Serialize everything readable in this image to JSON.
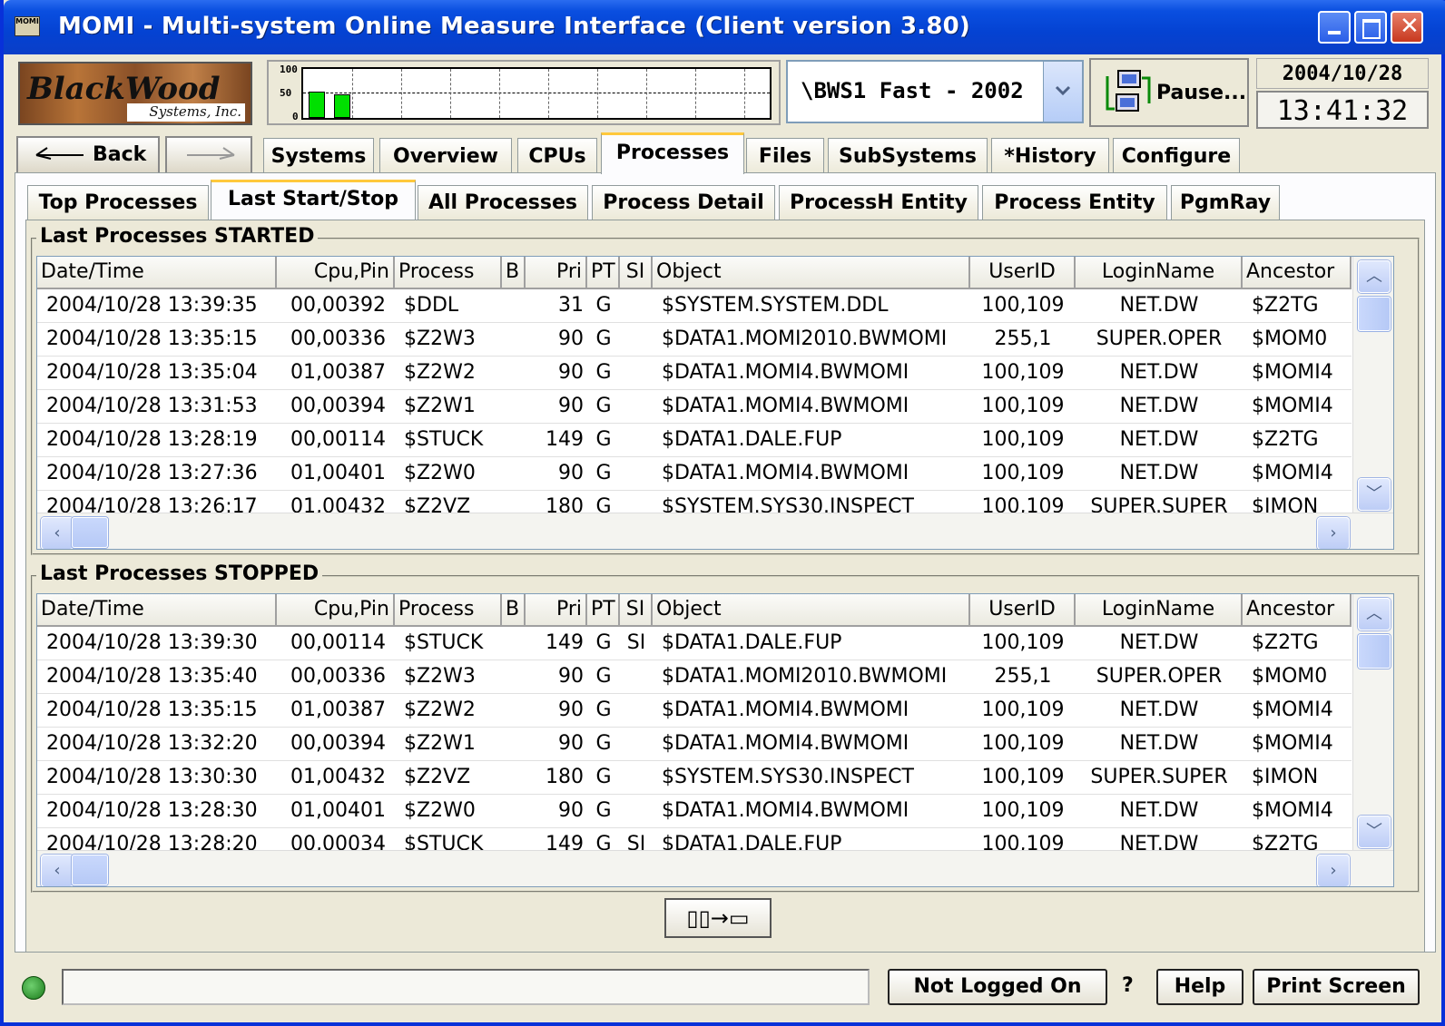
{
  "window": {
    "title": "MOMI - Multi-system Online Measure Interface (Client version 3.80)",
    "icon_label": "MOMI"
  },
  "header": {
    "logo_main": "BlackWood",
    "logo_sub": "Systems, Inc.",
    "meter": {
      "label_100": "100",
      "label_50": "50",
      "label_0": "0",
      "bars": [
        53,
        49
      ]
    },
    "system": "\\BWS1 Fast - 2002",
    "pause_label": "Pause...",
    "date": "2004/10/28",
    "time": "13:41:32"
  },
  "nav": {
    "back": "Back"
  },
  "main_tabs": [
    "Systems",
    "Overview",
    "CPUs",
    "Processes",
    "Files",
    "SubSystems",
    "*History",
    "Configure"
  ],
  "sub_tabs": [
    "Top Processes",
    "Last Start/Stop",
    "All Processes",
    "Process Detail",
    "ProcessH Entity",
    "Process Entity",
    "PgmRay"
  ],
  "columns": [
    "Date/Time",
    "Cpu,Pin",
    "Process",
    "B",
    "Pri",
    "PT",
    "SI",
    "Object",
    "UserID",
    "LoginName",
    "Ancestor"
  ],
  "started": {
    "title": "Last Processes STARTED",
    "rows": [
      [
        "2004/10/28 13:39:35",
        "00,00392",
        "$DDL",
        "",
        "31",
        "G",
        "",
        "$SYSTEM.SYSTEM.DDL",
        "100,109",
        "NET.DW",
        "$Z2TG"
      ],
      [
        "2004/10/28 13:35:15",
        "00,00336",
        "$Z2W3",
        "",
        "90",
        "G",
        "",
        "$DATA1.MOMI2010.BWMOMI",
        "255,1",
        "SUPER.OPER",
        "$MOM0"
      ],
      [
        "2004/10/28 13:35:04",
        "01,00387",
        "$Z2W2",
        "",
        "90",
        "G",
        "",
        "$DATA1.MOMI4.BWMOMI",
        "100,109",
        "NET.DW",
        "$MOMI4"
      ],
      [
        "2004/10/28 13:31:53",
        "00,00394",
        "$Z2W1",
        "",
        "90",
        "G",
        "",
        "$DATA1.MOMI4.BWMOMI",
        "100,109",
        "NET.DW",
        "$MOMI4"
      ],
      [
        "2004/10/28 13:28:19",
        "00,00114",
        "$STUCK",
        "",
        "149",
        "G",
        "",
        "$DATA1.DALE.FUP",
        "100,109",
        "NET.DW",
        "$Z2TG"
      ],
      [
        "2004/10/28 13:27:36",
        "01,00401",
        "$Z2W0",
        "",
        "90",
        "G",
        "",
        "$DATA1.MOMI4.BWMOMI",
        "100,109",
        "NET.DW",
        "$MOMI4"
      ],
      [
        "2004/10/28 13:26:17",
        "01,00432",
        "$Z2VZ",
        "",
        "180",
        "G",
        "",
        "$SYSTEM.SYS30.INSPECT",
        "100,109",
        "SUPER.SUPER",
        "$IMON"
      ]
    ]
  },
  "stopped": {
    "title": "Last Processes STOPPED",
    "rows": [
      [
        "2004/10/28 13:39:30",
        "00,00114",
        "$STUCK",
        "",
        "149",
        "G",
        "SI",
        "$DATA1.DALE.FUP",
        "100,109",
        "NET.DW",
        "$Z2TG"
      ],
      [
        "2004/10/28 13:35:40",
        "00,00336",
        "$Z2W3",
        "",
        "90",
        "G",
        "",
        "$DATA1.MOMI2010.BWMOMI",
        "255,1",
        "SUPER.OPER",
        "$MOM0"
      ],
      [
        "2004/10/28 13:35:15",
        "01,00387",
        "$Z2W2",
        "",
        "90",
        "G",
        "",
        "$DATA1.MOMI4.BWMOMI",
        "100,109",
        "NET.DW",
        "$MOMI4"
      ],
      [
        "2004/10/28 13:32:20",
        "00,00394",
        "$Z2W1",
        "",
        "90",
        "G",
        "",
        "$DATA1.MOMI4.BWMOMI",
        "100,109",
        "NET.DW",
        "$MOMI4"
      ],
      [
        "2004/10/28 13:30:30",
        "01,00432",
        "$Z2VZ",
        "",
        "180",
        "G",
        "",
        "$SYSTEM.SYS30.INSPECT",
        "100,109",
        "SUPER.SUPER",
        "$IMON"
      ],
      [
        "2004/10/28 13:28:30",
        "01,00401",
        "$Z2W0",
        "",
        "90",
        "G",
        "",
        "$DATA1.MOMI4.BWMOMI",
        "100,109",
        "NET.DW",
        "$MOMI4"
      ],
      [
        "2004/10/28 13:28:20",
        "00,00034",
        "$STUCK",
        "",
        "149",
        "G",
        "SI",
        "$DATA1.DALE.FUP",
        "100,109",
        "NET.DW",
        "$Z2TG"
      ]
    ]
  },
  "layout_button": "▯▯→▭",
  "statusbar": {
    "login": "Not Logged On",
    "question": "?",
    "help": "Help",
    "print": "Print Screen"
  }
}
